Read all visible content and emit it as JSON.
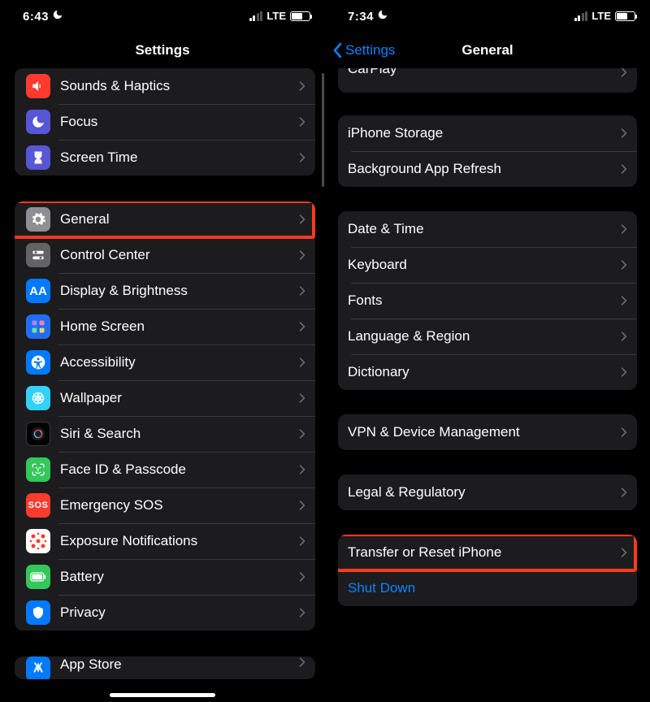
{
  "left": {
    "status": {
      "time": "6:43",
      "net": "LTE"
    },
    "title": "Settings",
    "rows": [
      {
        "id": "sounds",
        "label": "Sounds & Haptics"
      },
      {
        "id": "focus",
        "label": "Focus"
      },
      {
        "id": "screentime",
        "label": "Screen Time"
      },
      {
        "id": "general",
        "label": "General",
        "hl": true
      },
      {
        "id": "control",
        "label": "Control Center"
      },
      {
        "id": "display",
        "label": "Display & Brightness"
      },
      {
        "id": "home",
        "label": "Home Screen"
      },
      {
        "id": "access",
        "label": "Accessibility"
      },
      {
        "id": "wallpaper",
        "label": "Wallpaper"
      },
      {
        "id": "siri",
        "label": "Siri & Search"
      },
      {
        "id": "faceid",
        "label": "Face ID & Passcode"
      },
      {
        "id": "sos",
        "label": "Emergency SOS"
      },
      {
        "id": "exposure",
        "label": "Exposure Notifications"
      },
      {
        "id": "battery",
        "label": "Battery"
      },
      {
        "id": "privacy",
        "label": "Privacy"
      },
      {
        "id": "appstore",
        "label": "App Store"
      }
    ]
  },
  "right": {
    "status": {
      "time": "7:34",
      "net": "LTE"
    },
    "back": "Settings",
    "title": "General",
    "groups": [
      [
        {
          "id": "carplay",
          "label": "CarPlay",
          "cutTop": true
        }
      ],
      [
        {
          "id": "storage",
          "label": "iPhone Storage"
        },
        {
          "id": "bg",
          "label": "Background App Refresh"
        }
      ],
      [
        {
          "id": "datetime",
          "label": "Date & Time"
        },
        {
          "id": "keyboard",
          "label": "Keyboard"
        },
        {
          "id": "fonts",
          "label": "Fonts"
        },
        {
          "id": "lang",
          "label": "Language & Region"
        },
        {
          "id": "dict",
          "label": "Dictionary"
        }
      ],
      [
        {
          "id": "vpn",
          "label": "VPN & Device Management"
        }
      ],
      [
        {
          "id": "legal",
          "label": "Legal & Regulatory"
        }
      ],
      [
        {
          "id": "reset",
          "label": "Transfer or Reset iPhone",
          "hl": true
        },
        {
          "id": "shutdown",
          "label": "Shut Down",
          "link": true
        }
      ]
    ]
  }
}
